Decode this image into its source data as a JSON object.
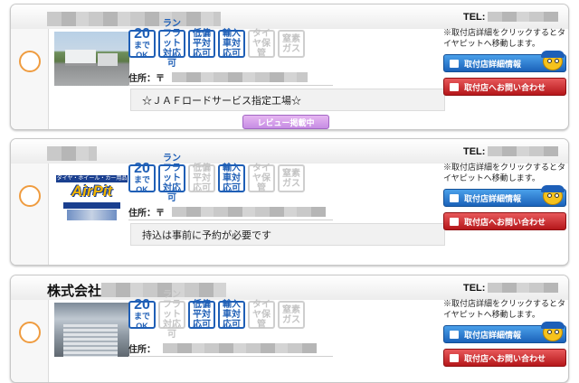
{
  "shops": [
    {
      "name_prefix": "",
      "tel_label": "TEL:",
      "address_label": "住所：〒",
      "note": "☆ＪＡＦロードサービス指定工場☆",
      "review_label": "レビュー掲載中",
      "thumb": "road-photo",
      "badges": [
        {
          "num": "20",
          "text": "までOK",
          "active": true
        },
        {
          "text": "ランフラット対応可",
          "active": true
        },
        {
          "text": "低偏平対応可",
          "active": true
        },
        {
          "text": "輸入車対応可",
          "active": true
        },
        {
          "text": "タイヤ保管",
          "active": false
        },
        {
          "text": "窒素ガス",
          "active": false
        }
      ]
    },
    {
      "name_prefix": "",
      "tel_label": "TEL:",
      "address_label": "住所：〒",
      "note": "持込は事前に予約が必要です",
      "thumb": "airpit-logo",
      "badges": [
        {
          "num": "20",
          "text": "までOK",
          "active": true
        },
        {
          "text": "ランフラット対応可",
          "active": true
        },
        {
          "text": "低偏平対応可",
          "active": false
        },
        {
          "text": "輸入車対応可",
          "active": true
        },
        {
          "text": "タイヤ保管",
          "active": false
        },
        {
          "text": "窒素ガス",
          "active": false
        }
      ]
    },
    {
      "name_prefix": "株式会社",
      "tel_label": "TEL:",
      "address_label": "住所：",
      "note": "",
      "thumb": "garage-photo",
      "badges": [
        {
          "num": "20",
          "text": "までOK",
          "active": true
        },
        {
          "text": "ランフラット対応可",
          "active": false
        },
        {
          "text": "低偏平対応可",
          "active": true
        },
        {
          "text": "輸入車対応可",
          "active": true
        },
        {
          "text": "タイヤ保管",
          "active": false
        },
        {
          "text": "窒素ガス",
          "active": false
        }
      ]
    }
  ],
  "common": {
    "click_note": "※取付店詳細をクリックするとタイヤピットへ移動します。",
    "detail_button": "取付店詳細情報",
    "contact_button": "取付店へお問い合わせ",
    "airpit_tagline": "タイヤ・ホイール・カー用品",
    "airpit_logo": "AirPit"
  },
  "colors": {
    "accent_blue": "#1f5fb6",
    "radio_orange": "#ef9c40",
    "contact_red": "#c4181b",
    "review_purple": "#c68ce4"
  }
}
